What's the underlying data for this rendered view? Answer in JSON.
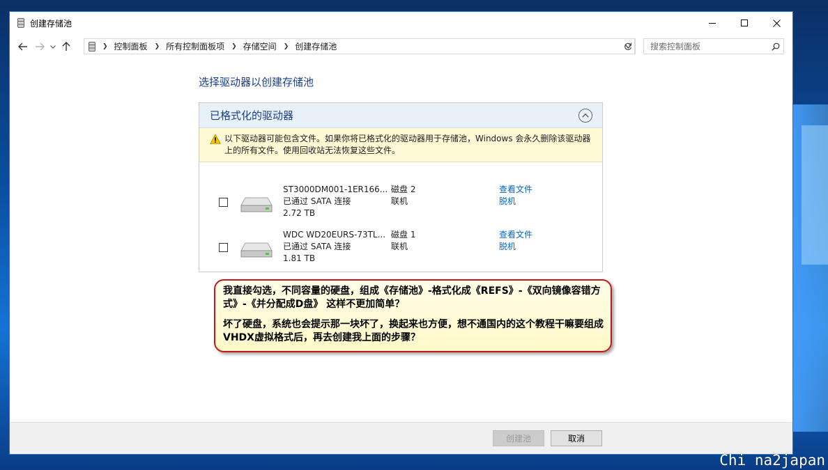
{
  "window": {
    "title": "创建存储池"
  },
  "navigation": {
    "breadcrumbs": [
      "控制面板",
      "所有控制面板项",
      "存储空间",
      "创建存储池"
    ],
    "search_placeholder": "搜索控制面板"
  },
  "main": {
    "heading": "选择驱动器以创建存储池",
    "section": {
      "title": "已格式化的驱动器",
      "warning": "以下驱动器可能包含文件。如果你将已格式化的驱动器用于存储池，Windows 会永久删除该驱动器上的所有文件。使用回收站无法恢复这些文件。",
      "drives": [
        {
          "name": "ST3000DM001-1ER166...",
          "connection": "已通过 SATA 连接",
          "size": "2.72 TB",
          "disk": "磁盘 2",
          "status": "联机",
          "view_files": "查看文件",
          "offline": "脱机",
          "checked": false
        },
        {
          "name": "WDC WD20EURS-73TL...",
          "connection": "已通过 SATA 连接",
          "size": "1.81 TB",
          "disk": "磁盘 1",
          "status": "联机",
          "view_files": "查看文件",
          "offline": "脱机",
          "checked": false
        }
      ]
    }
  },
  "callout": {
    "paragraph1": "我直接勾选，不同容量的硬盘，组成《存储池》-格式化成《REFS》-《双向镜像容错方式》-《并分配成D盘》 这样不更加简单？",
    "paragraph2": "坏了硬盘，系统也会提示那一块坏了，换起来也方便，想不通国内的这个教程干嘛要组成VHDX虚拟格式后，再去创建我上面的步骤？"
  },
  "footer": {
    "create_label": "创建池",
    "cancel_label": "取消"
  },
  "watermark": "Chi na2japan",
  "colors": {
    "accent_link": "#0066cc",
    "heading_blue": "#1a3f8c",
    "callout_border": "#c8151b",
    "warning_bg": "#fdf9d4"
  }
}
